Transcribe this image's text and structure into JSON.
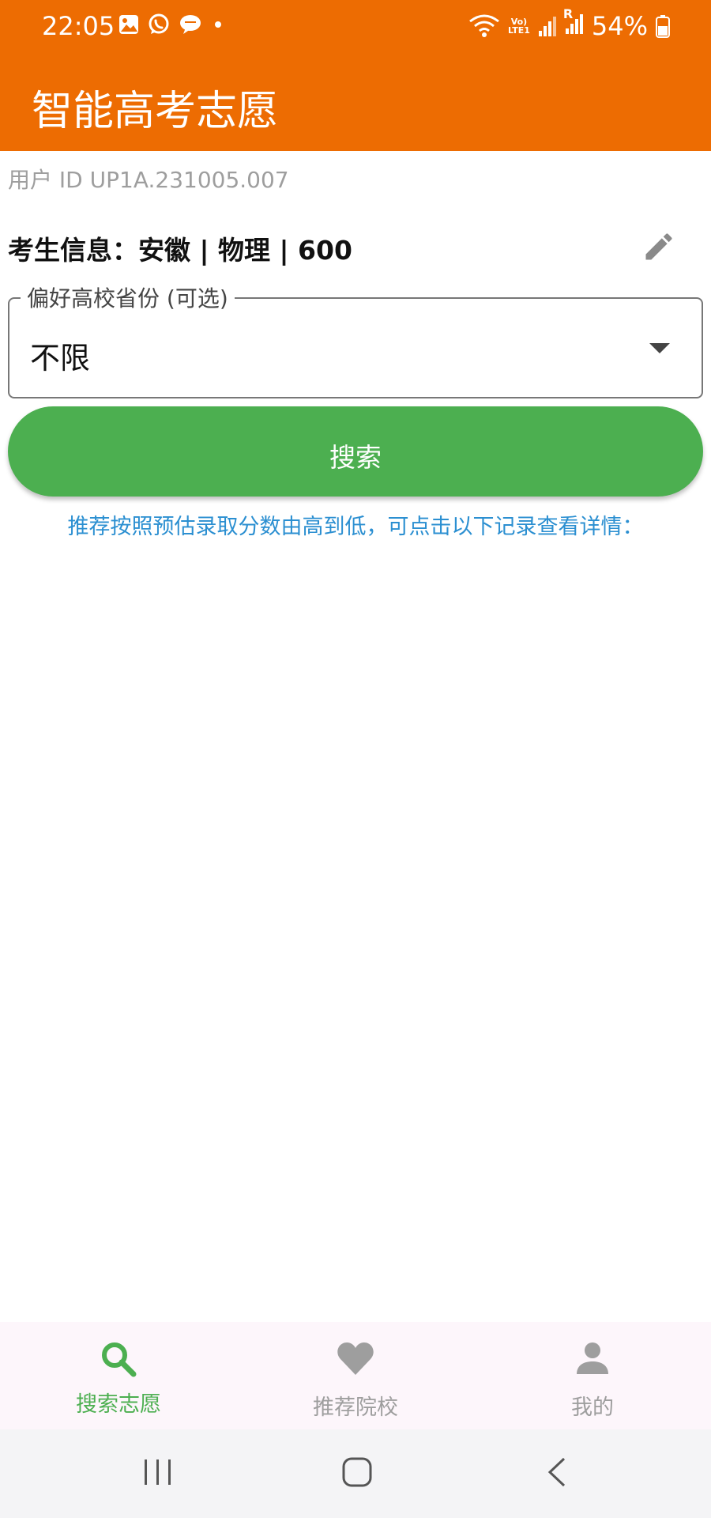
{
  "status_bar": {
    "time": "22:05",
    "network_label_top": "Vo)",
    "network_label_bottom": "LTE1",
    "sim_label": "R",
    "battery": "54%",
    "icons": [
      "gallery-icon",
      "whatsapp-icon",
      "chat-icon",
      "dot-icon",
      "wifi-icon",
      "signal-icon",
      "battery-icon"
    ]
  },
  "app_bar": {
    "title": "智能高考志愿"
  },
  "user_id": "用户 ID UP1A.231005.007",
  "student_info": "考生信息：安徽 | 物理 | 600",
  "province_select": {
    "label": "偏好高校省份 (可选)",
    "value": "不限"
  },
  "search_button": {
    "label": "搜索"
  },
  "hint": "推荐按照预估录取分数由高到低，可点击以下记录查看详情：",
  "bottom_nav": {
    "items": [
      {
        "label": "搜索志愿",
        "icon": "search-icon",
        "active": true
      },
      {
        "label": "推荐院校",
        "icon": "heart-icon",
        "active": false
      },
      {
        "label": "我的",
        "icon": "person-icon",
        "active": false
      }
    ]
  },
  "colors": {
    "app_bar": "#ED6C02",
    "primary_green": "#4CAF50",
    "hint_blue": "#2B8FD1",
    "inactive_gray": "#9E9E9E"
  }
}
